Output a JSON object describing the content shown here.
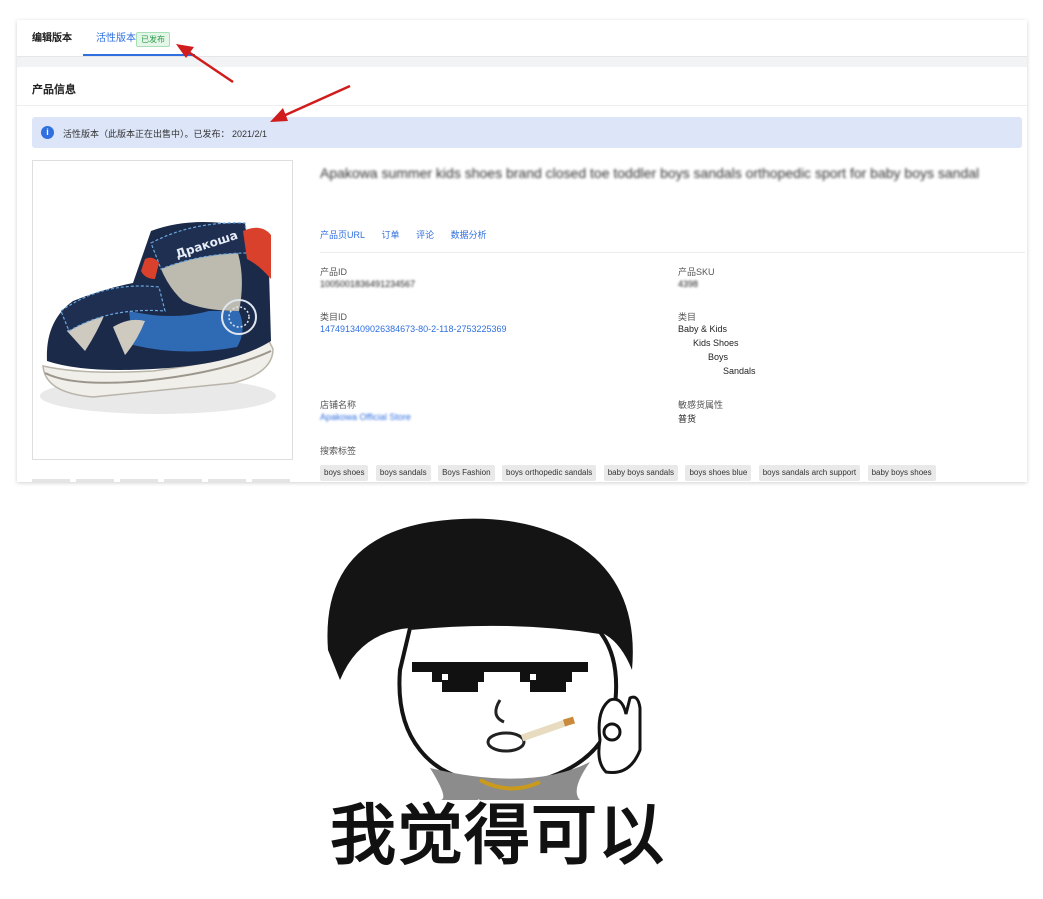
{
  "tabs": {
    "edit_label": "编辑版本",
    "active_label": "活性版本",
    "active_badge": "已发布"
  },
  "section": {
    "title": "产品信息"
  },
  "banner": {
    "icon": "info-icon",
    "text": "活性版本（此版本正在出售中）。已发布： 2021/2/1"
  },
  "product": {
    "title": "Apakowa summer kids shoes brand closed toe toddler boys sandals orthopedic sport for baby boys sandal",
    "image_brand_text": "Дракоша",
    "links": [
      "产品页URL",
      "订单",
      "评论",
      "数据分析"
    ],
    "fields": {
      "product_id_label": "产品ID",
      "product_id_value": "1005001836491234567",
      "product_sku_label": "产品SKU",
      "product_sku_value": "4398",
      "category_id_label": "类目ID",
      "category_id_value": "1474913409026384673-80-2-118-2753225369",
      "category_label": "类目",
      "category_path": [
        "Baby & Kids",
        "Kids Shoes",
        "Boys",
        "Sandals"
      ],
      "store_label": "店铺名称",
      "store_value": "Apakowa Official Store",
      "sensitive_label": "敏感货属性",
      "sensitive_value": "普货",
      "search_tags_label": "搜索标签"
    },
    "tags": [
      "boys shoes",
      "boys sandals",
      "Boys Fashion",
      "boys orthopedic sandals",
      "baby boys sandals",
      "boys shoes blue",
      "boys sandals arch support",
      "baby boys shoes"
    ]
  },
  "annotations": {
    "arrow_color": "#d01c1c"
  },
  "meme": {
    "caption": "我觉得可以"
  },
  "colors": {
    "accent": "#2f6fe0",
    "badge_green": "#2e9b48",
    "banner_bg": "#dde6f8"
  }
}
